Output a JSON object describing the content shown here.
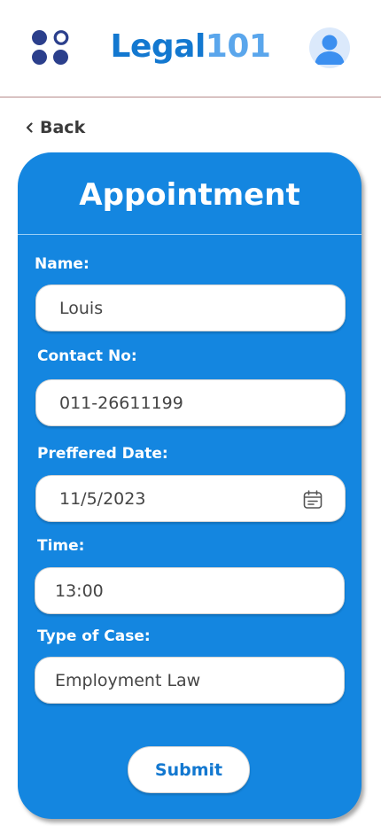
{
  "header": {
    "brand_part1": "Legal",
    "brand_part2": "101",
    "menu_icon": "app-grid-icon",
    "avatar_icon": "user-avatar-icon"
  },
  "nav": {
    "back_label": "Back",
    "back_icon": "chevron-left-icon"
  },
  "form": {
    "title": "Appointment",
    "fields": [
      {
        "label": "Name:",
        "value": "Louis"
      },
      {
        "label": "Contact No:",
        "value": "011-26611199"
      },
      {
        "label": "Preffered Date:",
        "value": "11/5/2023",
        "icon": "calendar-icon"
      },
      {
        "label": "Time:",
        "value": "13:00"
      },
      {
        "label": "Type of Case:",
        "value": "Employment Law"
      }
    ],
    "submit_label": "Submit"
  },
  "colors": {
    "brand_primary": "#1378d0",
    "brand_accent": "#5aa6ec",
    "card_background": "#1486e0",
    "icon_navy": "#2b3f8c"
  }
}
